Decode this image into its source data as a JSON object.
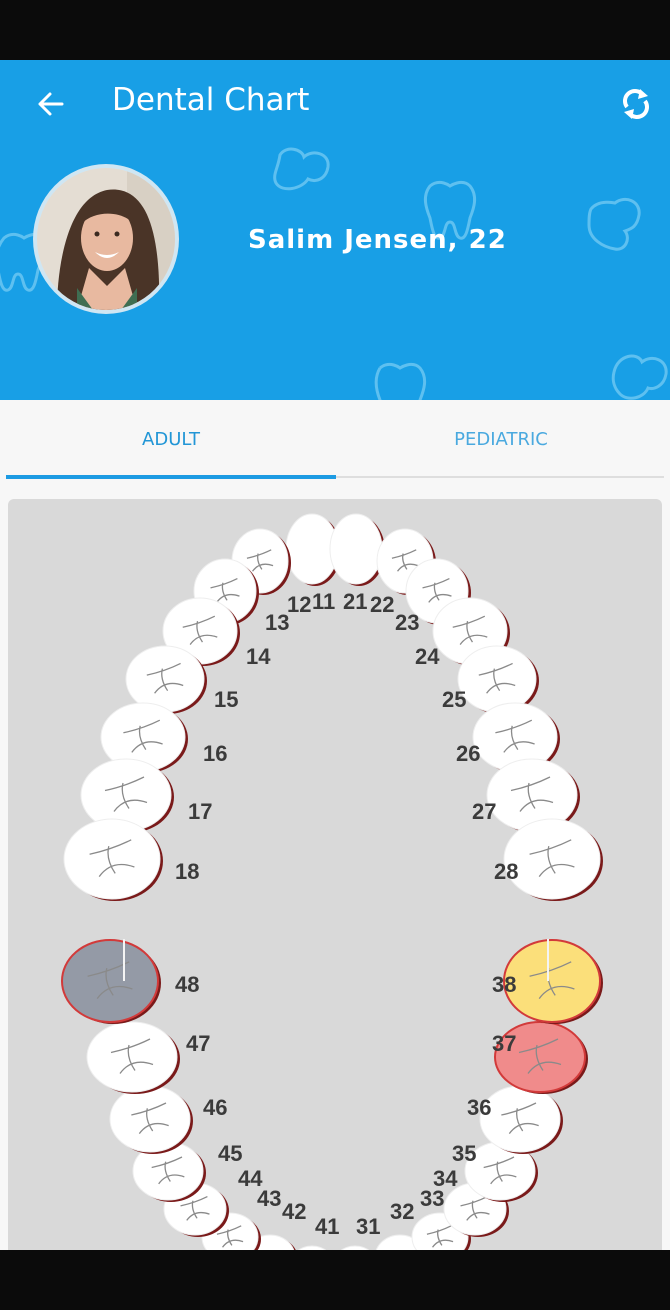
{
  "app": {
    "title": "Dental Chart",
    "back_icon": "arrow-left-icon",
    "refresh_icon": "refresh-icon"
  },
  "patient": {
    "label": "Salim Jensen, 22"
  },
  "tabs": [
    {
      "label": "ADULT",
      "selected": true
    },
    {
      "label": "PEDIATRIC",
      "selected": false
    }
  ],
  "colors": {
    "header": "#189fe6",
    "accent": "#1d9be3",
    "tooth_gray": "#949aa6",
    "tooth_yellow": "#fbdf7a",
    "tooth_red": "#f08b8b"
  },
  "teeth": [
    {
      "id": "11",
      "label": "11",
      "status": "normal"
    },
    {
      "id": "12",
      "label": "12",
      "status": "normal"
    },
    {
      "id": "13",
      "label": "13",
      "status": "normal"
    },
    {
      "id": "14",
      "label": "14",
      "status": "normal"
    },
    {
      "id": "15",
      "label": "15",
      "status": "normal"
    },
    {
      "id": "16",
      "label": "16",
      "status": "normal"
    },
    {
      "id": "17",
      "label": "17",
      "status": "normal"
    },
    {
      "id": "18",
      "label": "18",
      "status": "normal"
    },
    {
      "id": "21",
      "label": "21",
      "status": "normal"
    },
    {
      "id": "22",
      "label": "22",
      "status": "normal"
    },
    {
      "id": "23",
      "label": "23",
      "status": "normal"
    },
    {
      "id": "24",
      "label": "24",
      "status": "normal"
    },
    {
      "id": "25",
      "label": "25",
      "status": "normal"
    },
    {
      "id": "26",
      "label": "26",
      "status": "normal"
    },
    {
      "id": "27",
      "label": "27",
      "status": "normal"
    },
    {
      "id": "28",
      "label": "28",
      "status": "normal"
    },
    {
      "id": "31",
      "label": "31",
      "status": "normal"
    },
    {
      "id": "32",
      "label": "32",
      "status": "normal"
    },
    {
      "id": "33",
      "label": "33",
      "status": "normal"
    },
    {
      "id": "34",
      "label": "34",
      "status": "normal"
    },
    {
      "id": "35",
      "label": "35",
      "status": "normal"
    },
    {
      "id": "36",
      "label": "36",
      "status": "normal"
    },
    {
      "id": "37",
      "label": "37",
      "status": "red"
    },
    {
      "id": "38",
      "label": "38",
      "status": "yellow"
    },
    {
      "id": "41",
      "label": "41",
      "status": "normal"
    },
    {
      "id": "42",
      "label": "42",
      "status": "normal"
    },
    {
      "id": "43",
      "label": "43",
      "status": "normal"
    },
    {
      "id": "44",
      "label": "44",
      "status": "normal"
    },
    {
      "id": "45",
      "label": "45",
      "status": "normal"
    },
    {
      "id": "46",
      "label": "46",
      "status": "normal"
    },
    {
      "id": "47",
      "label": "47",
      "status": "normal"
    },
    {
      "id": "48",
      "label": "48",
      "status": "gray"
    }
  ]
}
